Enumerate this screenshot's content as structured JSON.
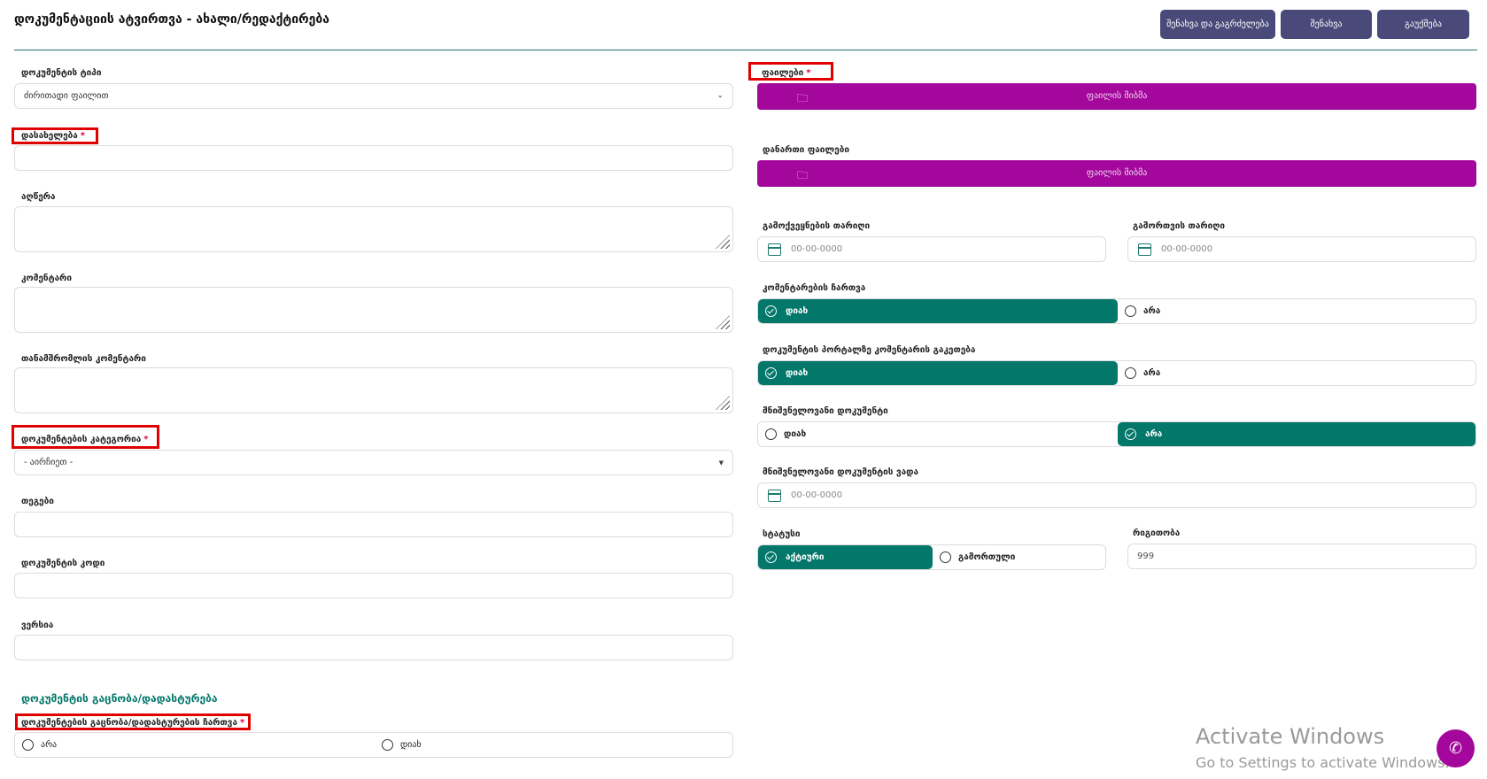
{
  "header": {
    "title": "დოკუმენტაციის ატვირთვა - ახალი/რედაქტირება",
    "save_continue": "შენახვა და გაგრძელება",
    "save": "შენახვა",
    "cancel": "გაუქმება"
  },
  "left": {
    "doc_type": {
      "label": "დოკუმენტის ტიპი",
      "value": "ძირითადი ფაილით"
    },
    "name": {
      "label": "დასახელება",
      "required": "*"
    },
    "description": {
      "label": "აღწერა"
    },
    "comment": {
      "label": "კომენტარი"
    },
    "employee_comment": {
      "label": "თანამშრომლის კომენტარი"
    },
    "category": {
      "label": "დოკუმენტების კატეგორია",
      "required": "*",
      "value": "- აირჩიეთ -"
    },
    "tags": {
      "label": "თეგები"
    },
    "code": {
      "label": "დოკუმენტის კოდი"
    },
    "version": {
      "label": "ვერსია"
    },
    "section_title": "დოკუმენტის გაცნობა/დადასტურება",
    "ack_enable": {
      "label": "დოკუმენტების გაცნობა/დადასტურების ჩართვა",
      "required": "*",
      "opt_no": "არა",
      "opt_yes": "დიახ"
    }
  },
  "right": {
    "files": {
      "label": "ფაილები",
      "required": "*",
      "button": "ფაილის მიბმა"
    },
    "attached_files": {
      "label": "დანართი ფაილები",
      "button": "ფაილის მიბმა"
    },
    "publish_date": {
      "label": "გამოქვეყნების თარიღი",
      "placeholder": "00-00-0000"
    },
    "removal_date": {
      "label": "გამორთვის თარიღი",
      "placeholder": "00-00-0000"
    },
    "comments_enable": {
      "label": "კომენტარების ჩართვა",
      "opt_yes": "დიახ",
      "opt_no": "არა",
      "selected": "yes"
    },
    "comment_on_portal": {
      "label": "დოკუმენტის პორტალზე კომენტარის გაკეთება",
      "opt_yes": "დიახ",
      "opt_no": "არა",
      "selected": "yes"
    },
    "important_doc": {
      "label": "მნიშვნელოვანი დოკუმენტი",
      "opt_yes": "დიახ",
      "opt_no": "არა",
      "selected": "no"
    },
    "important_deadline": {
      "label": "მნიშვნელოვანი დოკუმენტის ვადა",
      "placeholder": "00-00-0000"
    },
    "status": {
      "label": "სტატუსი",
      "opt_active": "აქტიური",
      "opt_inactive": "გამორთული",
      "selected": "active"
    },
    "order": {
      "label": "რიგითობა",
      "value": "999"
    }
  },
  "watermark": {
    "line1": "Activate Windows",
    "line2": "Go to Settings to activate Windows."
  },
  "colors": {
    "accent_green": "#02776a",
    "file_button": "#a3079b",
    "header_button": "#4a4a7a",
    "required_box": "#e00000"
  },
  "icons": [
    "folder-icon",
    "calendar-icon",
    "check-circle-icon",
    "phone-icon",
    "chevron-down-icon"
  ]
}
